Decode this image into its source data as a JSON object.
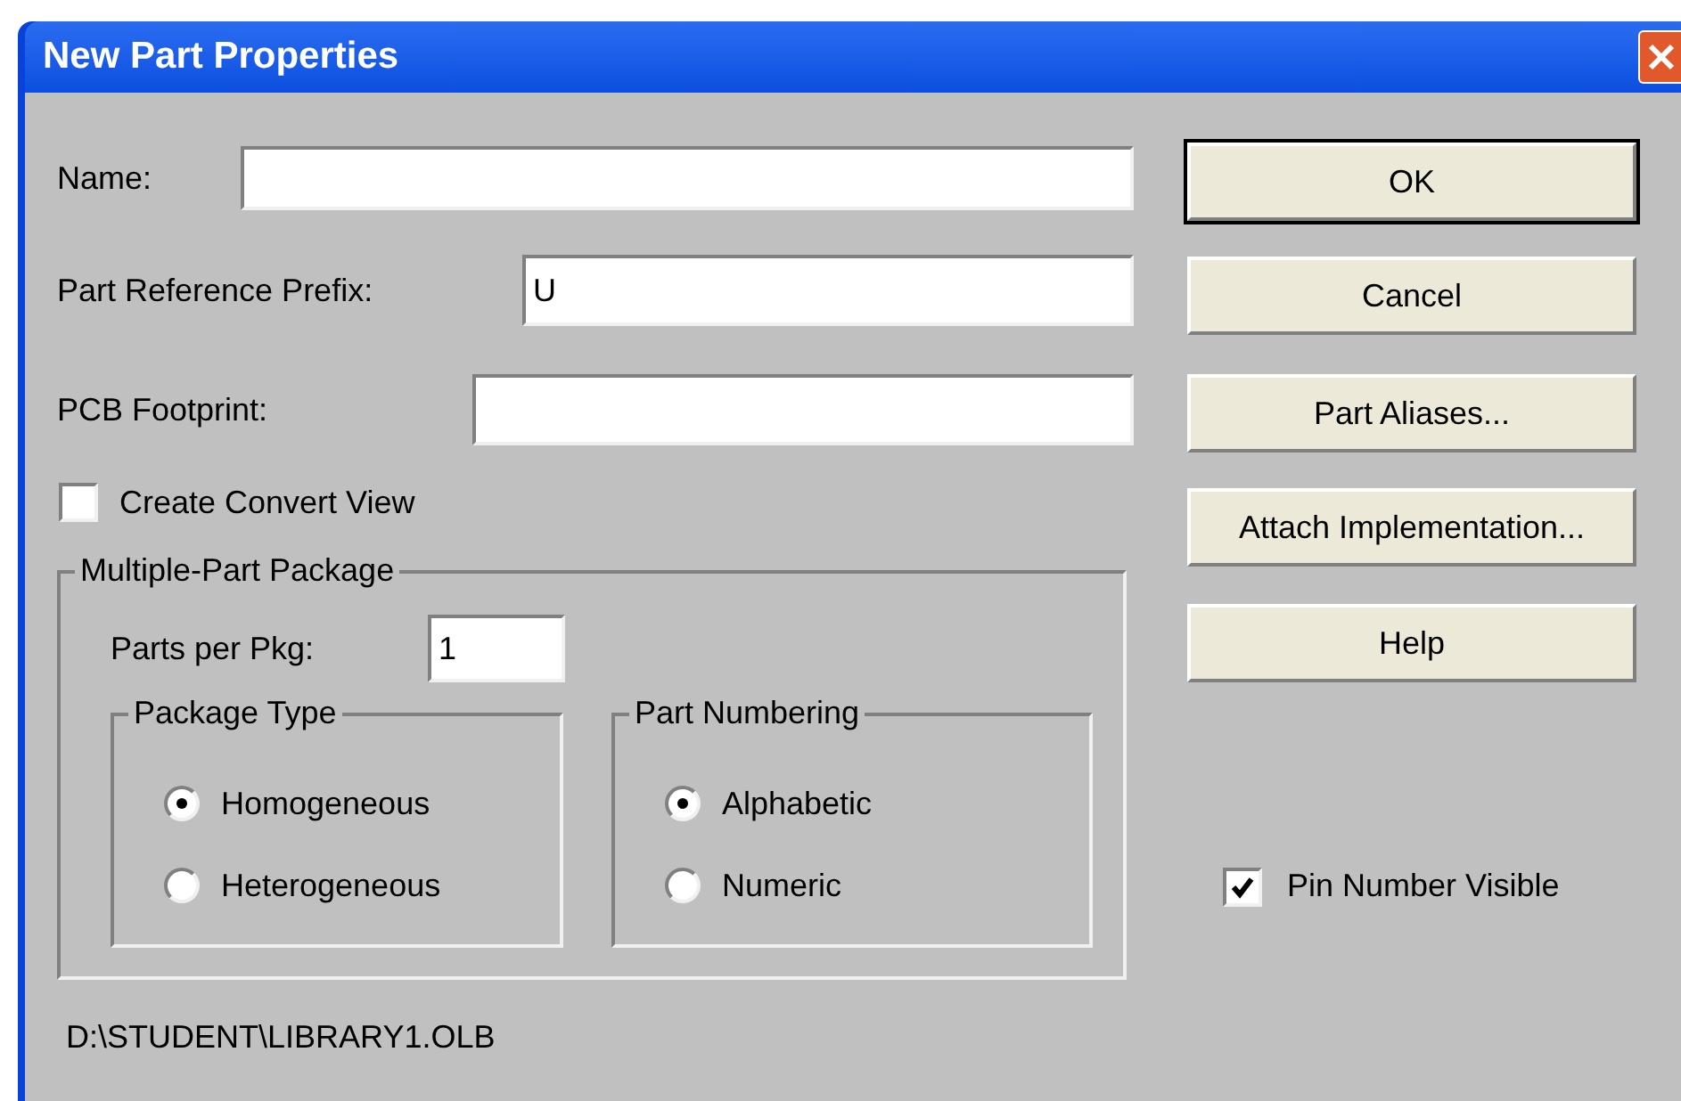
{
  "window": {
    "title": "New Part Properties"
  },
  "fields": [
    {
      "label": "Name:"
    },
    {
      "label": "Part Reference Prefix:",
      "value": "U"
    },
    {
      "label": "PCB Footprint:"
    }
  ],
  "create_convert_view": {
    "label": "Create Convert View",
    "checked": false
  },
  "package_group": {
    "title": "Multiple-Part Package",
    "parts_per_pkg": {
      "label": "Parts per Pkg:",
      "value": "1"
    },
    "package_type": {
      "title": "Package Type",
      "options": [
        {
          "label": "Homogeneous",
          "selected": true
        },
        {
          "label": "Heterogeneous",
          "selected": false
        }
      ]
    },
    "part_numbering": {
      "title": "Part Numbering",
      "options": [
        {
          "label": "Alphabetic",
          "selected": true
        },
        {
          "label": "Numeric",
          "selected": false
        }
      ]
    }
  },
  "library_path": "D:\\STUDENT\\LIBRARY1.OLB",
  "buttons": [
    {
      "label": "OK",
      "default": true
    },
    {
      "label": "Cancel",
      "default": false
    },
    {
      "label": "Part Aliases...",
      "default": false
    },
    {
      "label": "Attach Implementation...",
      "default": false
    },
    {
      "label": "Help",
      "default": false
    }
  ],
  "pin_number_visible": {
    "label": "Pin Number Visible",
    "checked": true
  }
}
